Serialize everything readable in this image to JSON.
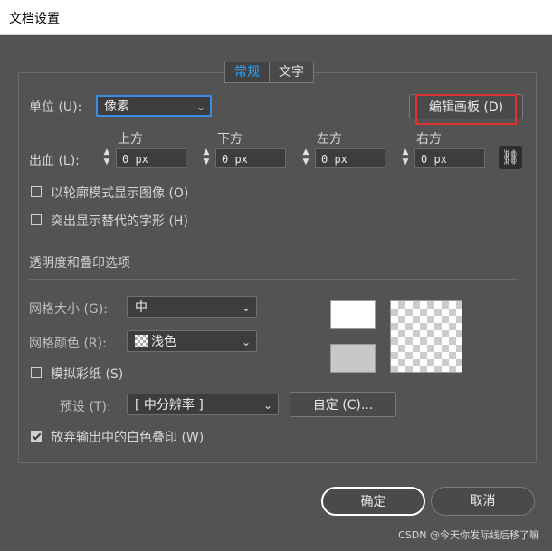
{
  "window": {
    "title": "文档设置"
  },
  "tabs": [
    {
      "label": "常规",
      "active": true
    },
    {
      "label": "文字",
      "active": false
    }
  ],
  "units": {
    "label": "单位 (U):",
    "value": "像素"
  },
  "edit_artboard_button": "编辑画板 (D)",
  "bleed": {
    "label": "出血 (L):",
    "fields": [
      {
        "header": "上方",
        "value": "0 px"
      },
      {
        "header": "下方",
        "value": "0 px"
      },
      {
        "header": "左方",
        "value": "0 px"
      },
      {
        "header": "右方",
        "value": "0 px"
      }
    ],
    "link_icon": "link-icon"
  },
  "checkboxes": {
    "outline_images": {
      "label": "以轮廓模式显示图像 (O)",
      "checked": false
    },
    "highlight_glyphs": {
      "label": "突出显示替代的字形 (H)",
      "checked": false
    }
  },
  "transparency": {
    "section_title": "透明度和叠印选项",
    "grid_size": {
      "label": "网格大小 (G):",
      "value": "中"
    },
    "grid_color": {
      "label": "网格颜色 (R):",
      "value": "浅色"
    },
    "simulate_paper": {
      "label": "模拟彩纸 (S)",
      "checked": false
    },
    "preset": {
      "label": "预设 (T):",
      "value": "[ 中分辨率 ]"
    },
    "custom_button": "自定 (C)...",
    "discard_white_overprint": {
      "label": "放弃输出中的白色叠印 (W)",
      "checked": true
    },
    "swatch_colors": {
      "top": "#ffffff",
      "bottom": "#c8c8c8"
    }
  },
  "footer": {
    "ok": "确定",
    "cancel": "取消"
  },
  "watermark": "CSDN @今天你发际线后移了嘛",
  "colors": {
    "accent": "#2aa5ff",
    "highlight": "#e03030",
    "focus": "#3a8ee6"
  }
}
